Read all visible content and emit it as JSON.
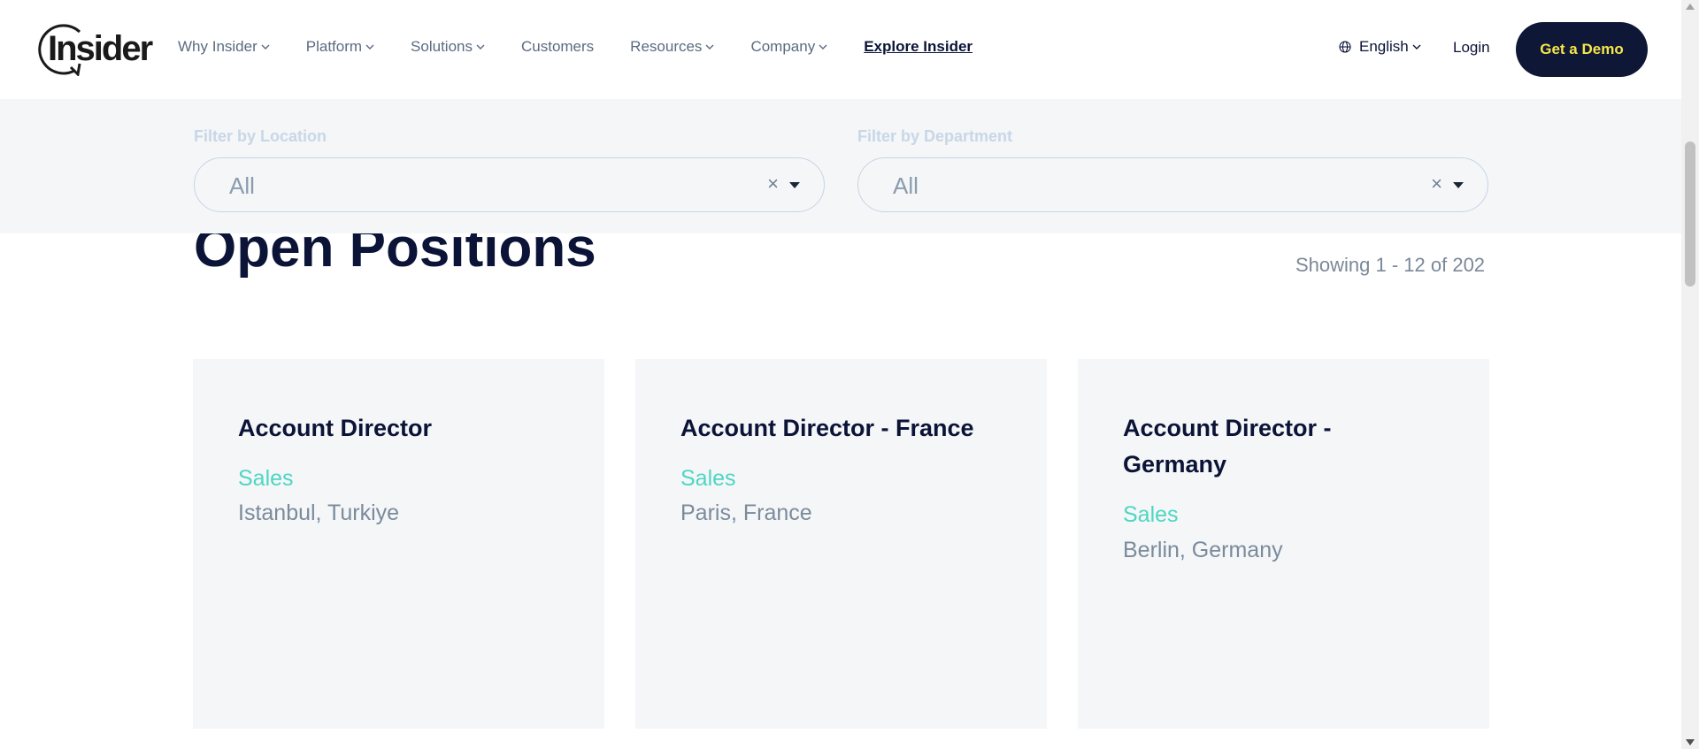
{
  "header": {
    "logo_text": "Insider",
    "nav": [
      {
        "label": "Why Insider",
        "dropdown": true
      },
      {
        "label": "Platform",
        "dropdown": true
      },
      {
        "label": "Solutions",
        "dropdown": true
      },
      {
        "label": "Customers",
        "dropdown": false
      },
      {
        "label": "Resources",
        "dropdown": true
      },
      {
        "label": "Company",
        "dropdown": true
      },
      {
        "label": "Explore Insider",
        "dropdown": false
      }
    ],
    "language": "English",
    "login": "Login",
    "cta": "Get a Demo"
  },
  "filters": {
    "location": {
      "label": "Filter by Location",
      "value": "All",
      "clear": "×"
    },
    "department": {
      "label": "Filter by Department",
      "value": "All",
      "clear": "×"
    }
  },
  "main": {
    "title": "Open Positions",
    "showing": "Showing 1 - 12 of 202"
  },
  "positions": [
    {
      "title": "Account Director",
      "department": "Sales",
      "location": "Istanbul, Turkiye"
    },
    {
      "title": "Account Director - France",
      "department": "Sales",
      "location": "Paris, France"
    },
    {
      "title": "Account Director - Germany",
      "department": "Sales",
      "location": "Berlin, Germany"
    }
  ],
  "colors": {
    "brand_navy": "#0e1735",
    "cta_text": "#f6e54b",
    "department_accent": "#4dd6c2",
    "card_bg": "#f5f6f8"
  },
  "icons": {
    "logo": "insider-logo",
    "language": "globe-icon",
    "nav_dropdown": "chevron-down-icon",
    "filter_clear": "close-icon",
    "filter_open": "caret-down-icon"
  }
}
